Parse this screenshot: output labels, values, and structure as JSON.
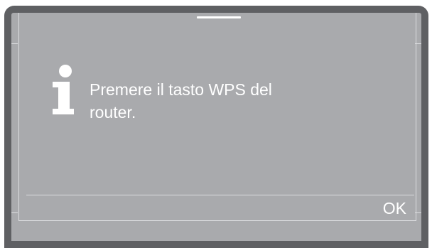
{
  "dialog": {
    "icon": "info-icon",
    "message_line1": "Premere il tasto WPS del",
    "message_line2": "router.",
    "ok_label": "OK"
  },
  "colors": {
    "bezel": "#5f6063",
    "screen": "#a9aaad",
    "text": "#ffffff",
    "frame_lines": "#dcdde0"
  }
}
